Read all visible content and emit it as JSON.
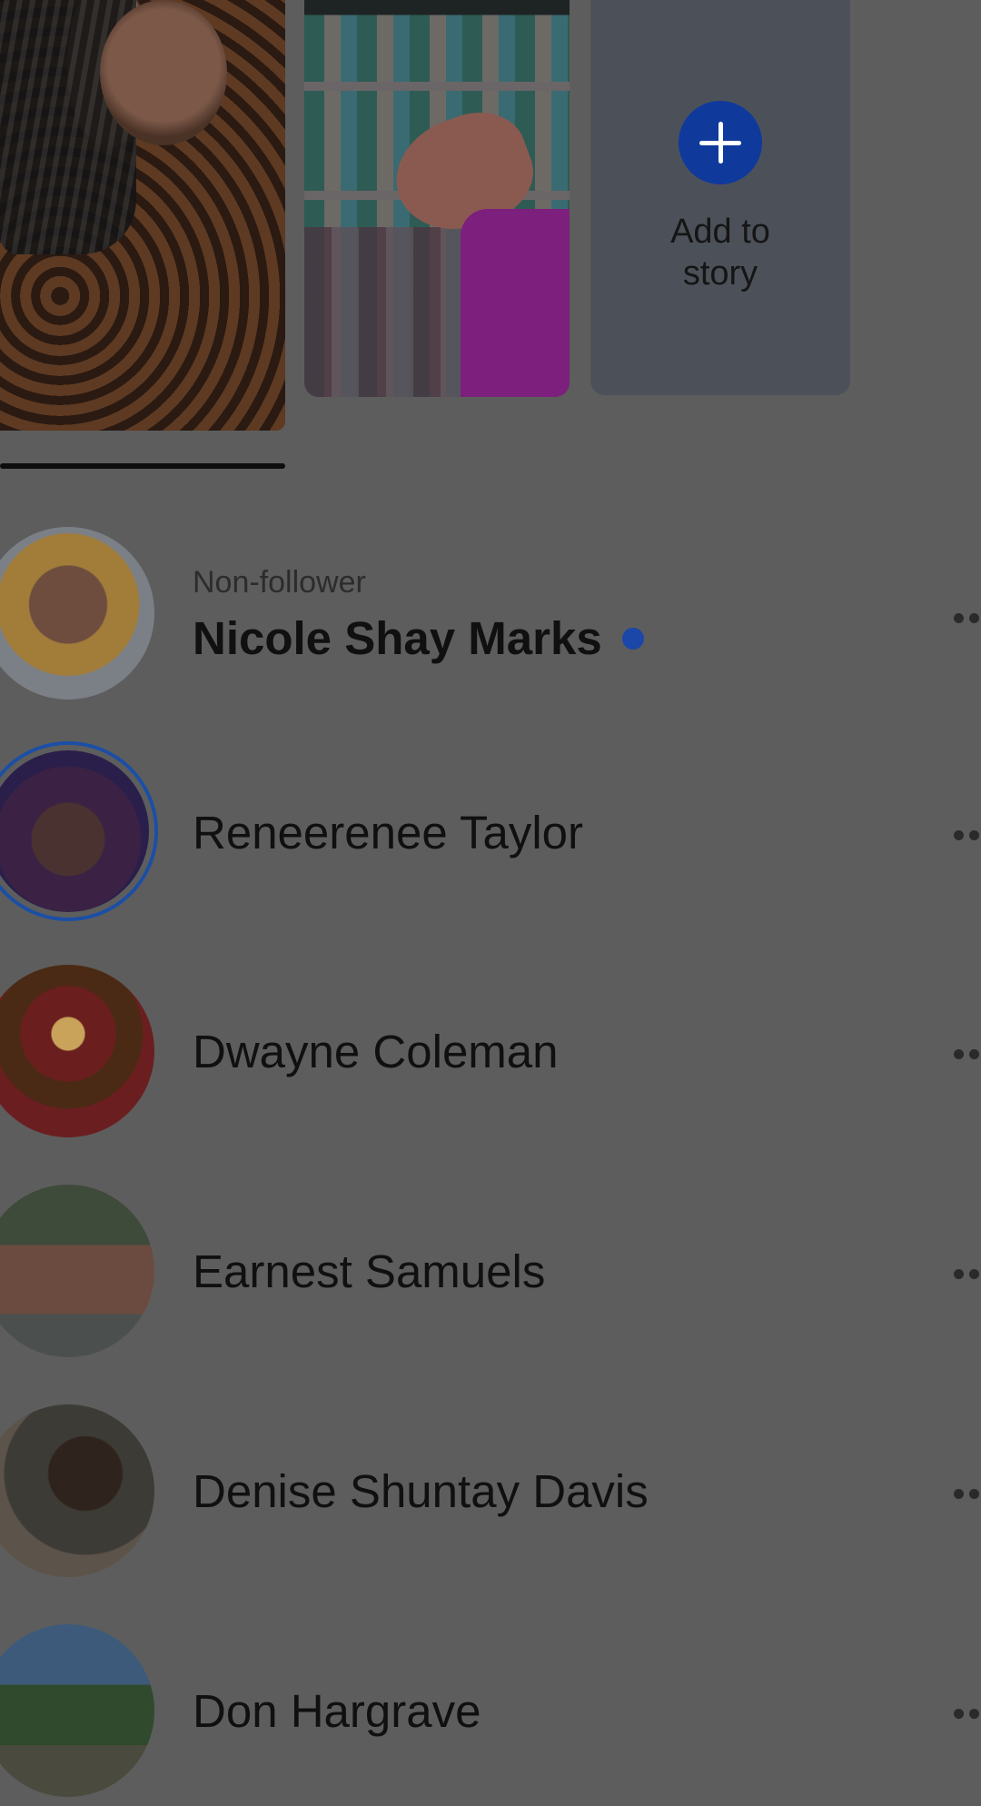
{
  "stories": {
    "add_to_story_label": "Add to\nstory"
  },
  "contacts": [
    {
      "subtitle": "Non-follower",
      "name": "Nicole Shay Marks",
      "bold": true,
      "unread": true,
      "avatar": "avatar-photo-woman-blonde"
    },
    {
      "subtitle": "",
      "name": "Reneerenee Taylor",
      "bold": false,
      "unread": false,
      "active_story_ring": true,
      "avatar": "avatar-photo-woman-purple"
    },
    {
      "subtitle": "",
      "name": "Dwayne Coleman",
      "bold": false,
      "unread": false,
      "avatar": "avatar-team-logo-train"
    },
    {
      "subtitle": "",
      "name": "Earnest Samuels",
      "bold": false,
      "unread": false,
      "avatar": "avatar-photo-baseball"
    },
    {
      "subtitle": "",
      "name": "Denise Shuntay Davis",
      "bold": false,
      "unread": false,
      "avatar": "avatar-photo-child"
    },
    {
      "subtitle": "",
      "name": "Don Hargrave",
      "bold": false,
      "unread": false,
      "avatar": "avatar-photo-palm-trees"
    }
  ],
  "colors": {
    "accent": "#1a47a8",
    "overlay_background": "#5d5d5d"
  },
  "icons": {
    "add": "plus-icon",
    "row_menu": "more-horizontal-icon"
  }
}
